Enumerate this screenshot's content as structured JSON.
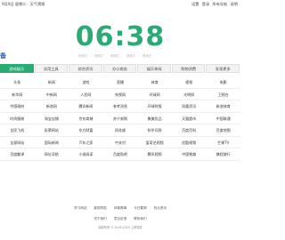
{
  "topbar": {
    "date": "9月9日 星期二 · 天气预报",
    "links": [
      "设置",
      "登录",
      "所有导航",
      "说明"
    ]
  },
  "clock": {
    "time": "06:38"
  },
  "logo": {
    "text": "备"
  },
  "search": {
    "engines": [
      "搜索栏",
      "搜索栏",
      "搜索栏",
      "搜索栏",
      "搜索栏"
    ]
  },
  "tabs": [
    "游戏娱乐",
    "实用工具",
    "综合资讯",
    "办公商务",
    "娱乐休闲",
    "购物消费",
    "发现更多"
  ],
  "links": [
    [
      "头条",
      "新闻",
      "游戏",
      "直播",
      "体育",
      "视频",
      "电影"
    ],
    [
      "新华网",
      "中新网",
      "人民网",
      "央视网",
      "环球网",
      "光明网",
      "卫视台"
    ],
    [
      "中国政府",
      "新浪网",
      "腾讯新闻",
      "参考消息",
      "环球时报",
      "凤凰资讯",
      "新浪体育"
    ],
    [
      "时尚服装",
      "淘宝店铺",
      "京东商城",
      "苏宁易购",
      "聚美优品",
      "天猫超市",
      "中国联通"
    ],
    [
      "全民飞机",
      "彩票网站",
      "东方财富",
      "同花顺",
      "知乎问答",
      "百度百科",
      "百度地图"
    ],
    [
      "全部网站",
      "国际新闻",
      "汽车之家",
      "中关村",
      "爱奇艺视频",
      "优酷视频",
      "芒果TV"
    ],
    [
      "百度翻译",
      "网址导航",
      "小说阅读",
      "百度贴吧",
      "腾讯视频",
      "中国铁路",
      "携程旅行"
    ]
  ],
  "bottom1": [
    "学习网站",
    "影视导航",
    "体育赛事",
    "今日要闻",
    "热点资讯"
  ],
  "bottom2": [
    "关于我们",
    "意见反馈",
    "联系我们"
  ],
  "footer": "版权所有 © 2016-2024 上网导航"
}
